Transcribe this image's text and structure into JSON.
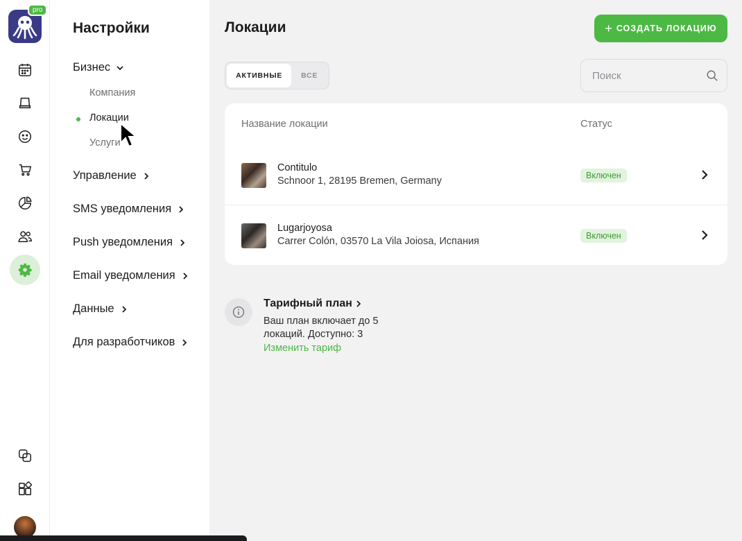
{
  "rail": {
    "pro_badge": "pro",
    "items": [
      {
        "icon": "calendar-icon"
      },
      {
        "icon": "stamp-icon"
      },
      {
        "icon": "smiley-icon"
      },
      {
        "icon": "cart-icon"
      },
      {
        "icon": "pie-chart-icon"
      },
      {
        "icon": "users-icon"
      },
      {
        "icon": "gear-icon",
        "active": true
      },
      {
        "icon": "copy-icon"
      },
      {
        "icon": "widgets-icon"
      }
    ]
  },
  "settings": {
    "title": "Настройки",
    "groups": [
      {
        "label": "Бизнес",
        "expanded": true,
        "sub": [
          "Компания",
          "Локации",
          "Услуги"
        ]
      },
      {
        "label": "Управление"
      },
      {
        "label": "SMS уведомления"
      },
      {
        "label": "Push уведомления"
      },
      {
        "label": "Email уведомления"
      },
      {
        "label": "Данные"
      },
      {
        "label": "Для разработчиков"
      }
    ],
    "active_sub": "Локации"
  },
  "main": {
    "title": "Локации",
    "create_button": "СОЗДАТЬ ЛОКАЦИЮ",
    "tabs": [
      {
        "label": "АКТИВНЫЕ",
        "active": true
      },
      {
        "label": "ВСЕ",
        "active": false
      }
    ],
    "search": {
      "placeholder": "Поиск",
      "value": ""
    },
    "table": {
      "columns": [
        "Название локации",
        "Статус"
      ],
      "rows": [
        {
          "name": "Contitulo",
          "address": "Schnoor 1, 28195 Bremen, Germany",
          "status": "Включен"
        },
        {
          "name": "Lugarjoyosa",
          "address": "Carrer Colón, 03570 La Vila Joiosa, Испания",
          "status": "Включен"
        }
      ]
    },
    "plan": {
      "title": "Тарифный план",
      "text": "Ваш план включает до 5 локаций. Доступно: 3",
      "link": "Изменить тариф"
    }
  },
  "colors": {
    "accent": "#4cb944",
    "badge_bg": "#e2f3de",
    "logo_bg": "#3a3a86"
  }
}
